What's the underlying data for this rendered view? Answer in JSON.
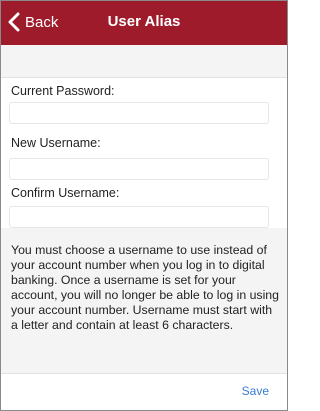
{
  "header": {
    "back_label": "Back",
    "title": "User Alias"
  },
  "form": {
    "current_password_label": "Current Password:",
    "current_password_value": "",
    "new_username_label": "New Username:",
    "new_username_value": "",
    "confirm_username_label": "Confirm Username:",
    "confirm_username_value": ""
  },
  "info": {
    "text": "You must choose a username to use instead of your account number when you log in to digital banking.  Once a username is set for your account, you will no longer be able to log in using your account number. Username must start with a letter and contain at least 6 characters."
  },
  "footer": {
    "save_label": "Save"
  },
  "colors": {
    "navbar": "#9e1b2b",
    "link": "#3a7bd5"
  }
}
